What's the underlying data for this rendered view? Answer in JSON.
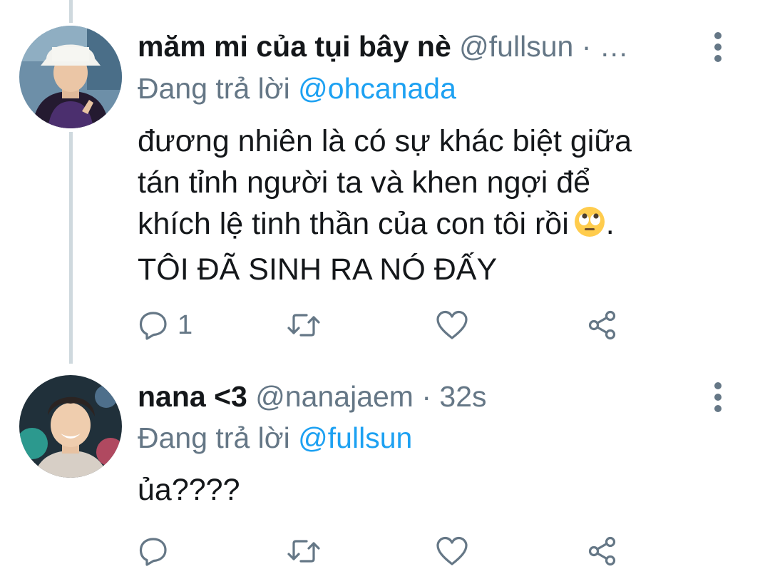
{
  "tweets": [
    {
      "display_name": "măm mi của tụi bây nè",
      "handle": "@fullsun",
      "separator": "·",
      "time": "…",
      "reply_prefix": "Đang trả lời",
      "reply_handle": "@ohcanada",
      "text_lines": [
        "đương nhiên là có sự khác biệt giữa",
        "tán tỉnh người ta và khen ngợi để",
        "khích lệ tinh thần của con tôi rồi",
        "TÔI ĐÃ SINH RA NÓ ĐẤY"
      ],
      "text_suffix": ".",
      "emoji": "face-with-rolling-eyes",
      "reply_count": "1"
    },
    {
      "display_name": "nana <3",
      "handle": "@nanajaem",
      "separator": "·",
      "time": "32s",
      "reply_prefix": "Đang trả lời",
      "reply_handle": "@fullsun",
      "text_lines": [
        "ủa????"
      ],
      "reply_count": ""
    }
  ],
  "icons": {
    "reply": "reply-icon",
    "retweet": "retweet-icon",
    "like": "heart-icon",
    "share": "share-icon",
    "more": "more-vertical-icon"
  },
  "colors": {
    "text": "#14171a",
    "muted": "#657786",
    "link": "#1da1f2",
    "thread_line": "#cfd9de"
  }
}
